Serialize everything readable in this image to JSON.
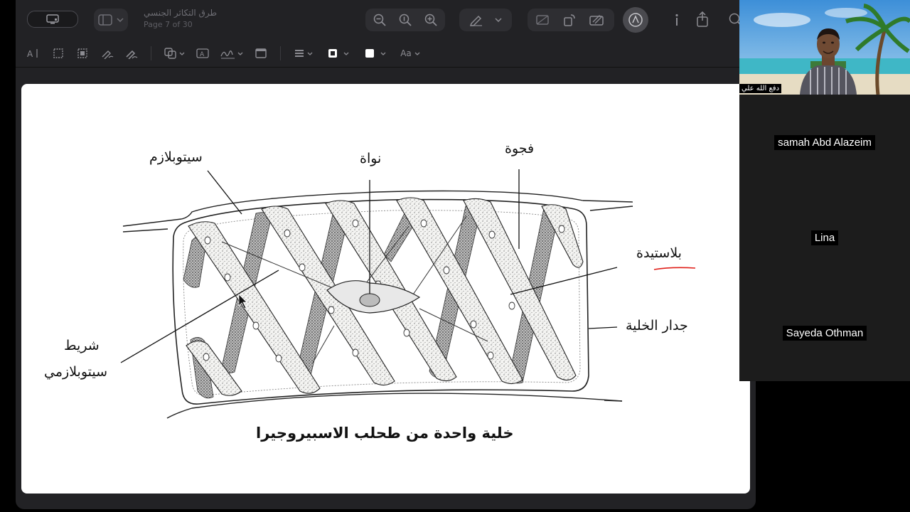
{
  "document": {
    "title": "طرق التكاثر الجنسي",
    "page_indicator": "Page 7 of 30"
  },
  "toolbar": {
    "sidebar_label": "",
    "text_style_label": "Aa"
  },
  "slide": {
    "labels": {
      "cytoplasm": "سيتوبلازم",
      "nucleus": "نواة",
      "vacuole": "فجوة",
      "plastid": "بلاستيدة",
      "cell_wall": "جدار الخلية",
      "strand_line1": "شريط",
      "strand_line2": "سيتوبلازمي"
    },
    "caption": "خلية واحدة من طحلب الاسبيروجيرا"
  },
  "participants": {
    "host": "دفع الله علي",
    "list": [
      {
        "name": "samah Abd Alazeim"
      },
      {
        "name": "Lina"
      },
      {
        "name": "Sayeda Othman"
      }
    ]
  },
  "colors": {
    "window_bg": "#222225",
    "toolbar_icon": "#8c8c92",
    "active_markup": "#4a4a4f",
    "underline": "#e0201a"
  }
}
